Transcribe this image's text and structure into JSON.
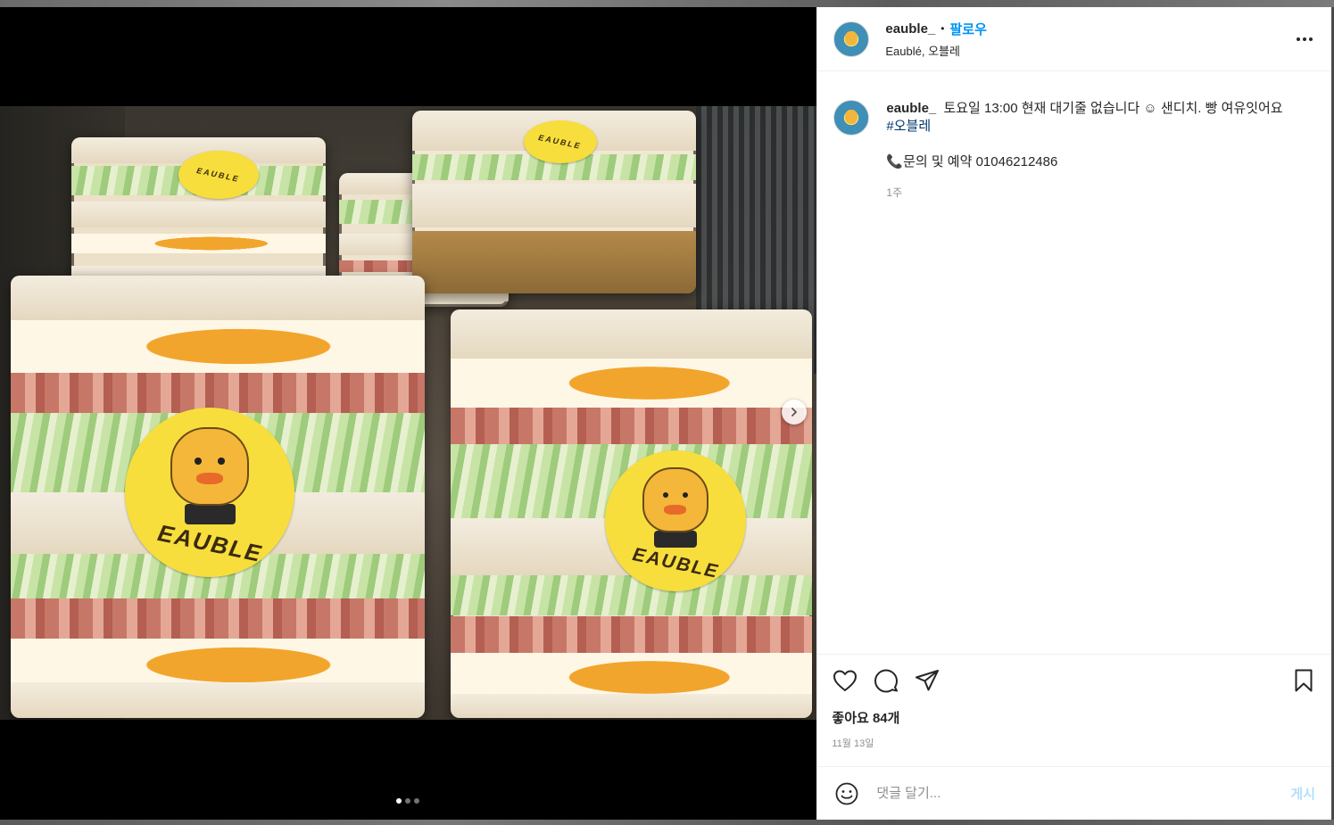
{
  "post": {
    "username": "eauble_",
    "separator": "•",
    "follow_label": "팔로우",
    "location": "Eaublé, 오블레",
    "more_icon": "more-horizontal-icon"
  },
  "caption": {
    "username": "eauble_",
    "text": "토요일 13:00 현재 대기줄 없습니다 ☺ 샌디치. 빵 여유잇어요",
    "hashtag": "#오블레",
    "contact": "📞문의 및 예약 01046212486",
    "time_ago": "1주"
  },
  "photo": {
    "sticker_text": "EAUBLE",
    "carousel": {
      "count": 3,
      "active": 1,
      "next_icon": "chevron-right-icon"
    }
  },
  "actions": {
    "icons": [
      "heart-icon",
      "comment-icon",
      "share-icon",
      "bookmark-icon"
    ],
    "likes": "좋아요 84개",
    "date": "11월 13일"
  },
  "comment": {
    "placeholder": "댓글 달기...",
    "post_label": "게시",
    "emoji_icon": "emoji-icon"
  },
  "colors": {
    "accent": "#0095f6",
    "hashtag": "#00376b",
    "post_disabled": "#b2dffc",
    "muted": "#8e8e8e",
    "sticker": "#f7de3c"
  }
}
